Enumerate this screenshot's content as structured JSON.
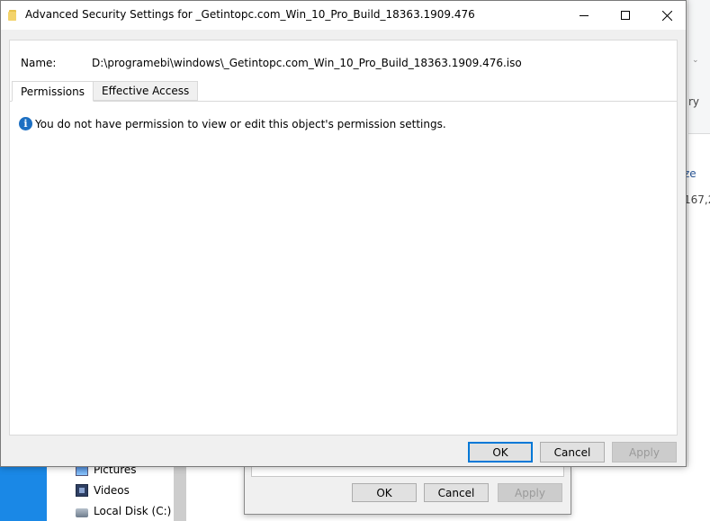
{
  "dialog": {
    "title": "Advanced Security Settings for _Getintopc.com_Win_10_Pro_Build_18363.1909.476",
    "name_label": "Name:",
    "name_value": "D:\\programebi\\windows\\_Getintopc.com_Win_10_Pro_Build_18363.1909.476.iso",
    "tabs": [
      {
        "label": "Permissions",
        "active": true
      },
      {
        "label": "Effective Access",
        "active": false
      }
    ],
    "info_icon": "info-icon",
    "message": "You do not have permission to view or edit this object's permission settings.",
    "buttons": {
      "ok": "OK",
      "cancel": "Cancel",
      "apply": "Apply"
    }
  },
  "background": {
    "nav_items": [
      {
        "label": "Pictures",
        "icon": "pictures-icon"
      },
      {
        "label": "Videos",
        "icon": "videos-icon"
      },
      {
        "label": "Local Disk (C:)",
        "icon": "local-disk-icon"
      }
    ],
    "right_fragments": [
      "ry",
      "ze",
      "167,2"
    ],
    "props_buttons": {
      "ok": "OK",
      "cancel": "Cancel",
      "apply": "Apply"
    }
  },
  "colors": {
    "accent": "#0078d7",
    "info": "#1c6fc2",
    "taskbar": "#1a88e6"
  }
}
